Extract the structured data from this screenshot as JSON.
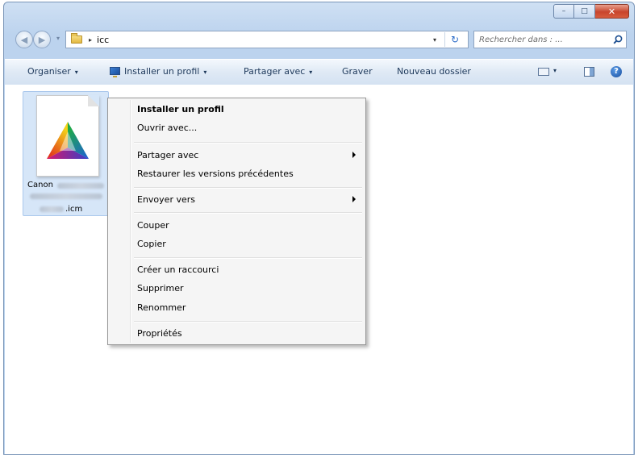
{
  "window": {
    "caption_min": "–",
    "caption_max": "□",
    "caption_close": "✕"
  },
  "address": {
    "breadcrumb_separator": "▸",
    "path": "icc",
    "dropdown_glyph": "▾",
    "refresh_glyph": "↻"
  },
  "search": {
    "placeholder": "Rechercher dans : ..."
  },
  "toolbar": {
    "organize": "Organiser",
    "install_profile": "Installer un profil",
    "share_with": "Partager avec",
    "burn": "Graver",
    "new_folder": "Nouveau dossier",
    "caret": "▾",
    "help": "?"
  },
  "file": {
    "name_start": "Canon",
    "extension": ".icm"
  },
  "context_menu": {
    "items": [
      {
        "label": "Installer un profil"
      },
      {
        "label": "Ouvrir avec..."
      },
      {
        "label": "Partager avec"
      },
      {
        "label": "Restaurer les versions précédentes"
      },
      {
        "label": "Envoyer vers"
      },
      {
        "label": "Couper"
      },
      {
        "label": "Copier"
      },
      {
        "label": "Créer un raccourci"
      },
      {
        "label": "Supprimer"
      },
      {
        "label": "Renommer"
      },
      {
        "label": "Propriétés"
      }
    ]
  },
  "colors": {
    "accent": "#1e395b",
    "selection": "#d6e6f8",
    "close_button": "#c8452c"
  }
}
